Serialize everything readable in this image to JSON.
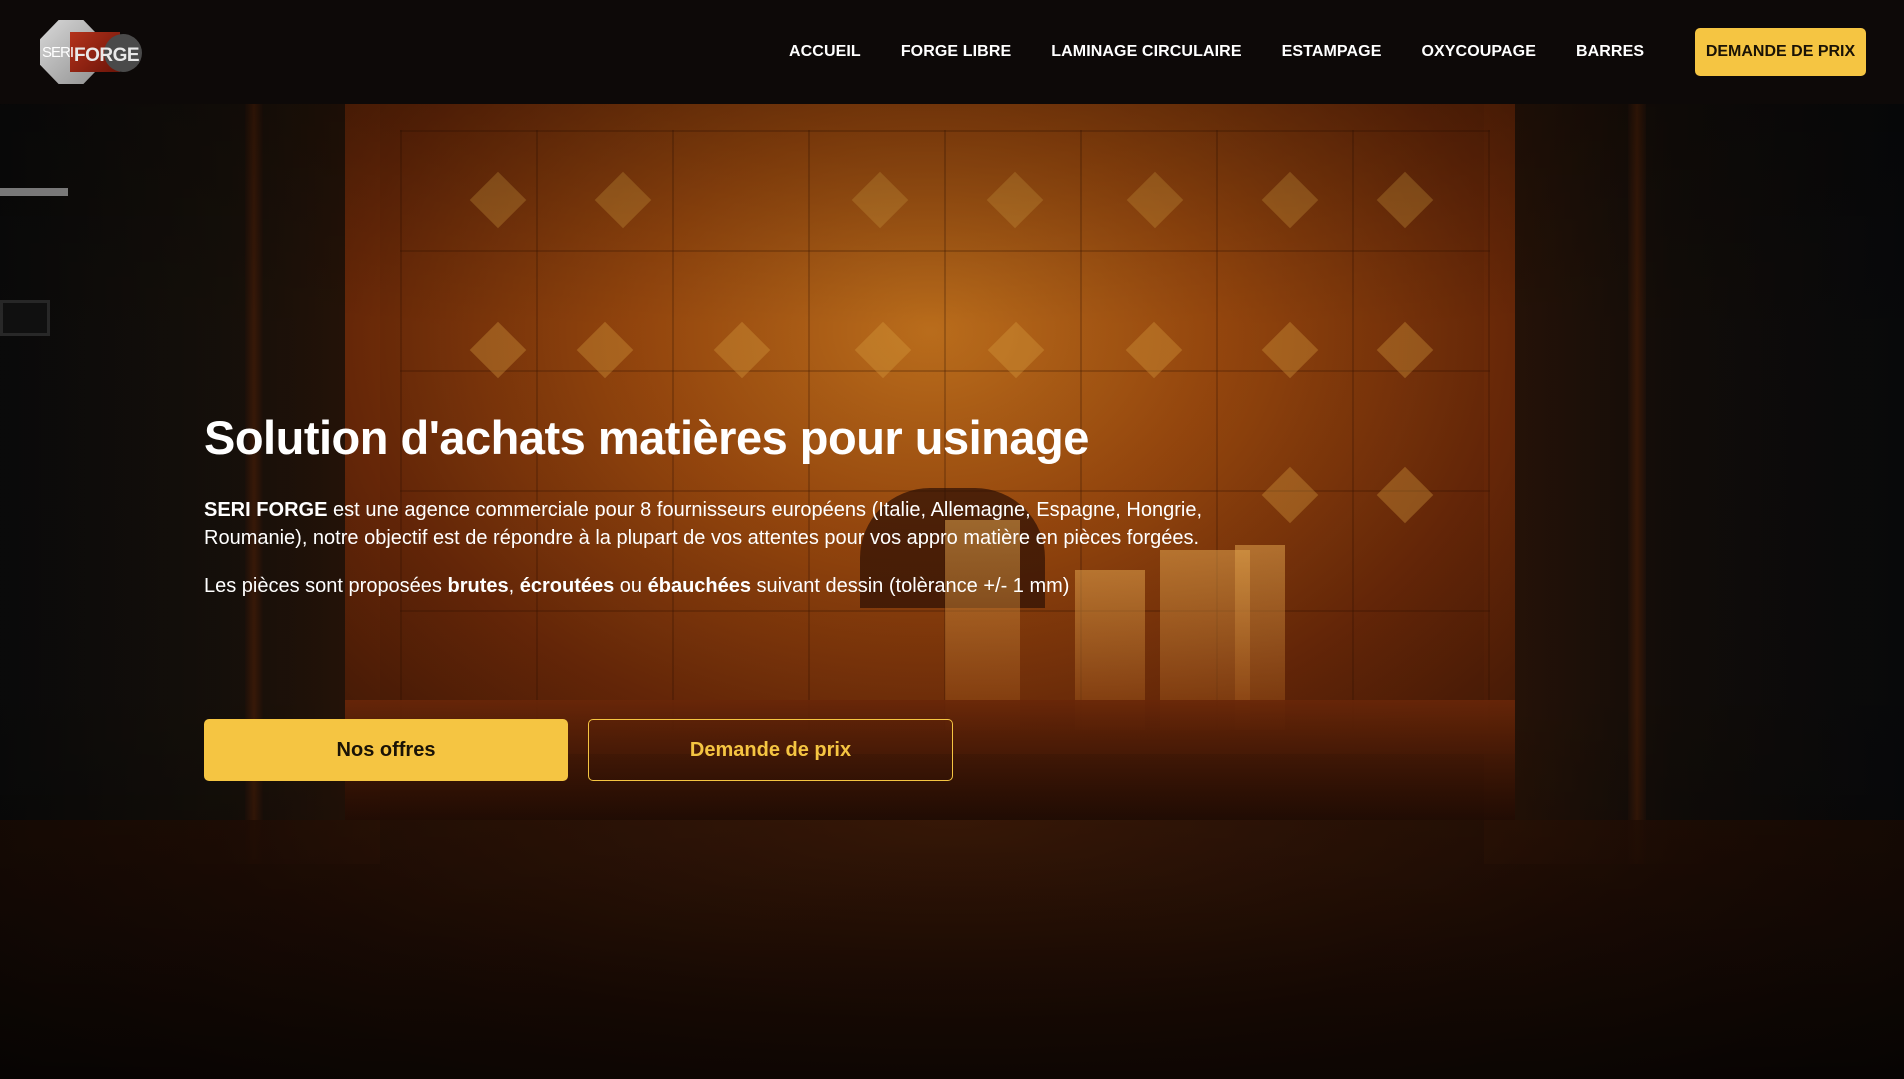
{
  "brand": {
    "logo_seri": "SERI",
    "logo_forge": "FORGE"
  },
  "nav": {
    "items": [
      {
        "label": "ACCUEIL"
      },
      {
        "label": "FORGE LIBRE"
      },
      {
        "label": "LAMINAGE CIRCULAIRE"
      },
      {
        "label": "ESTAMPAGE"
      },
      {
        "label": "OXYCOUPAGE"
      },
      {
        "label": "BARRES"
      }
    ],
    "cta_label": "DEMANDE DE PRIX"
  },
  "hero": {
    "title": "Solution d'achats matières pour usinage",
    "para1": {
      "company": "SERI FORGE",
      "text": " est une agence commerciale pour 8 fournisseurs européens (Italie, Allemagne, Espagne, Hongrie, Roumanie), notre objectif est de répondre à la plupart de vos attentes pour vos appro matière en pièces forgées."
    },
    "para2": {
      "intro": "Les pièces sont proposées ",
      "term1": "brutes",
      "sep1": ", ",
      "term2": "écroutées",
      "sep2": " ou ",
      "term3": "ébauchées",
      "outro": " suivant dessin (tolèrance +/- 1 mm)"
    },
    "primary_button": "Nos offres",
    "secondary_button": "Demande de prix"
  },
  "colors": {
    "accent": "#f5c542",
    "header_bg": "#0e0a08",
    "text": "#ffffff"
  },
  "icons": {
    "logo": "seri-forge-logo"
  }
}
